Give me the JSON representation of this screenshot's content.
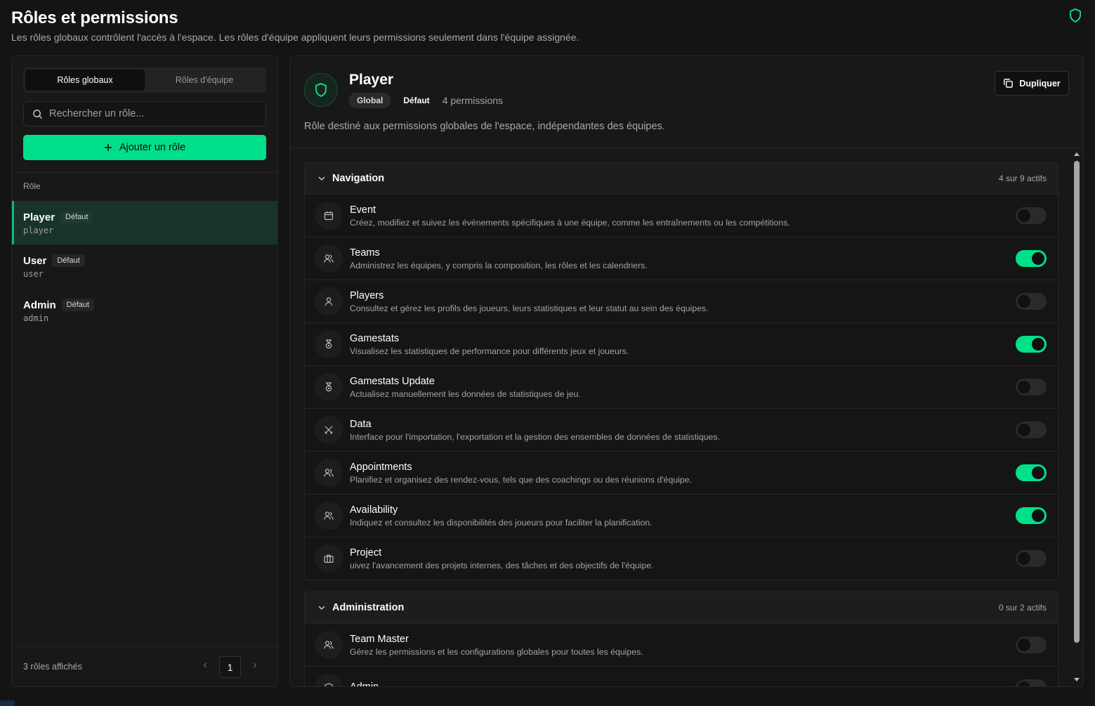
{
  "header": {
    "title": "Rôles et permissions",
    "subtitle": "Les rôles globaux contrôlent l'accès à l'espace. Les rôles d'équipe appliquent leurs permissions seulement dans l'équipe assignée.",
    "shield_icon": "shield-icon"
  },
  "sidebar": {
    "tabs": [
      {
        "label": "Rôles globaux",
        "active": true
      },
      {
        "label": "Rôles d'équipe",
        "active": false
      }
    ],
    "search": {
      "placeholder": "Rechercher un rôle...",
      "value": ""
    },
    "add_button": "Ajouter un rôle",
    "column_header": "Rôle",
    "roles": [
      {
        "name": "Player",
        "badge": "Défaut",
        "key": "player",
        "active": true
      },
      {
        "name": "User",
        "badge": "Défaut",
        "key": "user",
        "active": false
      },
      {
        "name": "Admin",
        "badge": "Défaut",
        "key": "admin",
        "active": false
      }
    ],
    "footer": {
      "count": "3 rôles affichés",
      "page": "1"
    }
  },
  "detail": {
    "title": "Player",
    "tag_scope": "Global",
    "tag_default": "Défaut",
    "perm_count": "4 permissions",
    "duplicate_button": "Dupliquer",
    "description": "Rôle destiné aux permissions globales de l'espace, indépendantes des équipes.",
    "accent_color": "#00e08a",
    "sections": [
      {
        "title": "Navigation",
        "count": "4 sur 9 actifs",
        "items": [
          {
            "name": "Event",
            "desc": "Créez, modifiez et suivez les événements spécifiques à une équipe, comme les entraînements ou les compétitions.",
            "icon": "calendar-icon",
            "enabled": false
          },
          {
            "name": "Teams",
            "desc": "Administrez les équipes, y compris la composition, les rôles et les calendriers.",
            "icon": "users-icon",
            "enabled": true
          },
          {
            "name": "Players",
            "desc": "Consultez et gérez les profils des joueurs, leurs statistiques et leur statut au sein des équipes.",
            "icon": "user-icon",
            "enabled": false
          },
          {
            "name": "Gamestats",
            "desc": "Visualisez les statistiques de performance pour différents jeux et joueurs.",
            "icon": "medal-icon",
            "enabled": true
          },
          {
            "name": "Gamestats Update",
            "desc": "Actualisez manuellement les données de statistiques de jeu.",
            "icon": "medal-icon",
            "enabled": false
          },
          {
            "name": "Data",
            "desc": "Interface pour l'importation, l'exportation et la gestion des ensembles de données de statistiques.",
            "icon": "swords-icon",
            "enabled": false
          },
          {
            "name": "Appointments",
            "desc": "Planifiez et organisez des rendez-vous, tels que des coachings ou des réunions d'équipe.",
            "icon": "users-icon",
            "enabled": true
          },
          {
            "name": "Availability",
            "desc": "Indiquez et consultez les disponibilités des joueurs pour faciliter la planification.",
            "icon": "users-icon",
            "enabled": true
          },
          {
            "name": "Project",
            "desc": "uivez l'avancement des projets internes, des tâches et des objectifs de l'équipe.",
            "icon": "briefcase-icon",
            "enabled": false
          }
        ]
      },
      {
        "title": "Administration",
        "count": "0 sur 2 actifs",
        "items": [
          {
            "name": "Team Master",
            "desc": "Gérez les permissions et les configurations globales pour toutes les équipes.",
            "icon": "users-icon",
            "enabled": false
          },
          {
            "name": "Admin",
            "desc": "",
            "icon": "shield-icon",
            "enabled": false
          }
        ]
      }
    ]
  }
}
